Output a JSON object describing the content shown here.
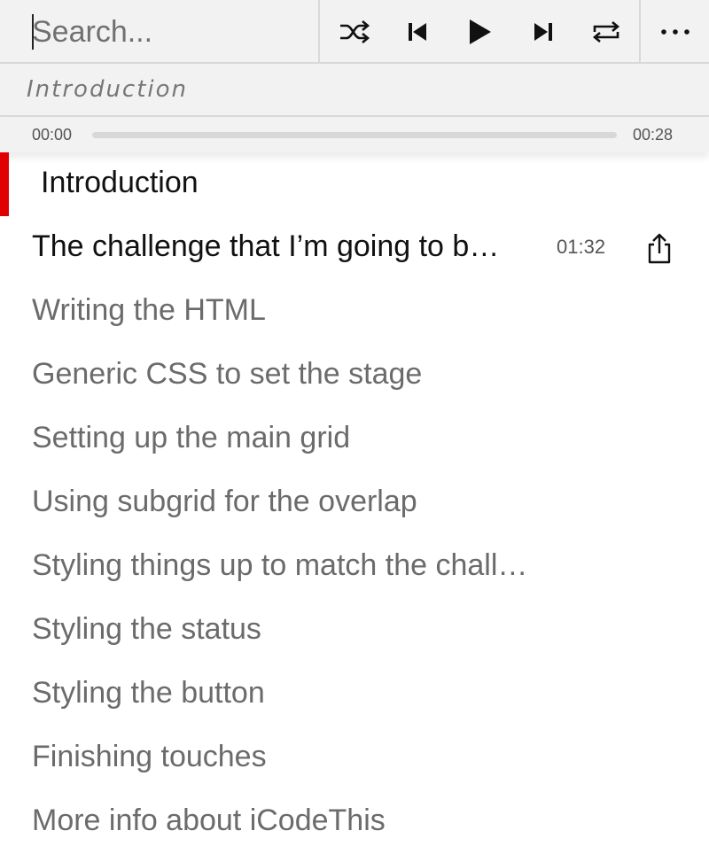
{
  "search": {
    "placeholder": "Search...",
    "value": ""
  },
  "controls": {
    "shuffle_icon": "shuffle-icon",
    "previous_icon": "skip-previous-icon",
    "play_icon": "play-icon",
    "next_icon": "skip-next-icon",
    "repeat_icon": "repeat-icon",
    "more_icon": "more-horizontal-icon"
  },
  "now_playing": {
    "chapter": "Introduction"
  },
  "progress": {
    "elapsed": "00:00",
    "total": "00:28",
    "fraction": 0
  },
  "chapters": [
    {
      "label": "Introduction",
      "state": "active"
    },
    {
      "label": "The challenge that I’m going to b…",
      "duration": "01:32",
      "state": "current"
    },
    {
      "label": "Writing the HTML",
      "state": "normal"
    },
    {
      "label": "Generic CSS to set the stage",
      "state": "normal"
    },
    {
      "label": "Setting up the main grid",
      "state": "normal"
    },
    {
      "label": "Using subgrid for the overlap",
      "state": "normal"
    },
    {
      "label": "Styling things up to match the challenge",
      "state": "normal"
    },
    {
      "label": "Styling the status",
      "state": "normal"
    },
    {
      "label": "Styling the button",
      "state": "normal"
    },
    {
      "label": "Finishing touches",
      "state": "normal"
    },
    {
      "label": "More info about iCodeThis",
      "state": "normal"
    }
  ],
  "colors": {
    "active_marker": "#e00000",
    "toolbar_bg": "#f2f2f2",
    "inactive_text": "#6b6b6b",
    "active_text": "#111111"
  }
}
